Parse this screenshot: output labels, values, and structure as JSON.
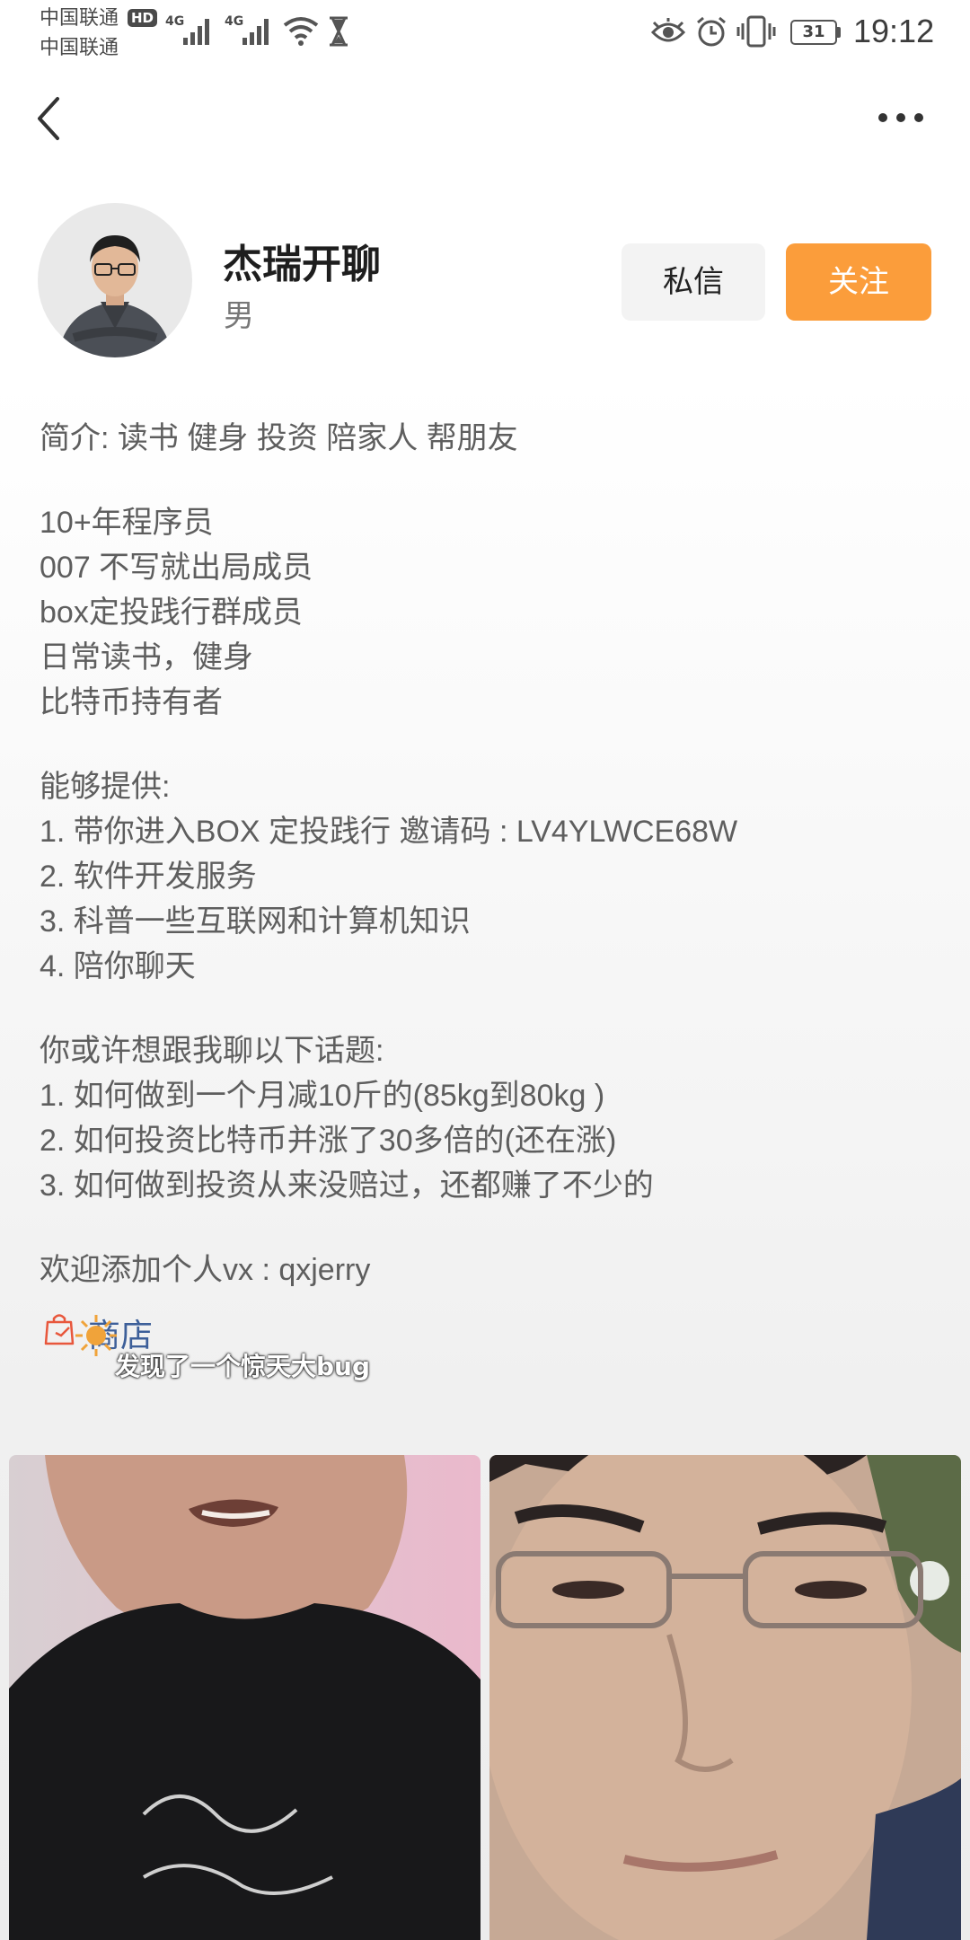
{
  "status_bar": {
    "carrier_1": "中国联通",
    "carrier_2": "中国联通",
    "hd": "HD",
    "network_1": "4G",
    "network_2": "4G",
    "battery": "31",
    "time": "19:12"
  },
  "profile": {
    "name": "杰瑞开聊",
    "gender": "男",
    "message_label": "私信",
    "follow_label": "关注",
    "follow_color": "#fb9d3b"
  },
  "bio": [
    "简介: 读书 健身 投资 陪家人 帮朋友",
    "10+年程序员",
    "007 不写就出局成员",
    "box定投践行群成员",
    "日常读书，健身",
    "比特币持有者",
    "能够提供:",
    "1. 带你进入BOX 定投践行 邀请码 : LV4YLWCE68W",
    "2. 软件开发服务",
    "3. 科普一些互联网和计算机知识",
    "4. 陪你聊天",
    "你或许想跟我聊以下话题:",
    "1. 如何做到一个月减10斤的(85kg到80kg )",
    "2. 如何投资比特币并涨了30多倍的(还在涨)",
    "3. 如何做到投资从来没赔过，还都赚了不少的",
    "欢迎添加个人vx : qxjerry"
  ],
  "shop": {
    "label": "商店",
    "color": "#3d5f99"
  },
  "videos": [
    {
      "caption": "发现了一个惊天大bug"
    },
    {
      "caption": ""
    }
  ]
}
